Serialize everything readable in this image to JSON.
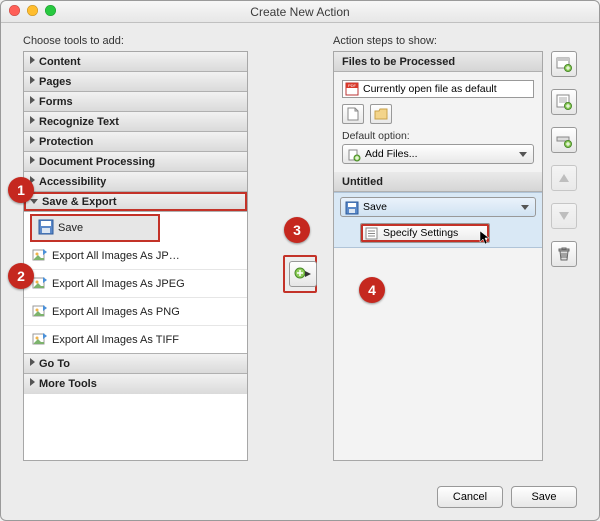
{
  "window": {
    "title": "Create New Action"
  },
  "left": {
    "label": "Choose tools to add:",
    "groups": {
      "content": "Content",
      "pages": "Pages",
      "forms": "Forms",
      "recognize": "Recognize Text",
      "protection": "Protection",
      "docproc": "Document Processing",
      "accessibility": "Accessibility",
      "saveexport": "Save & Export",
      "goto": "Go To",
      "moretools": "More Tools"
    },
    "tools": {
      "save": "Save",
      "exp_jp": "Export All Images As JP…",
      "exp_jpeg": "Export All Images As JPEG",
      "exp_png": "Export All Images As PNG",
      "exp_tiff": "Export All Images As TIFF"
    }
  },
  "right": {
    "label": "Action steps to show:",
    "sec_files": "Files to be Processed",
    "file_default": "Currently open file as default",
    "default_label": "Default option:",
    "add_files": "Add Files...",
    "sec_untitled": "Untitled",
    "step_save": "Save",
    "specify": "Specify Settings"
  },
  "footer": {
    "cancel": "Cancel",
    "save": "Save"
  },
  "callouts": {
    "c1": "1",
    "c2": "2",
    "c3": "3",
    "c4": "4"
  }
}
